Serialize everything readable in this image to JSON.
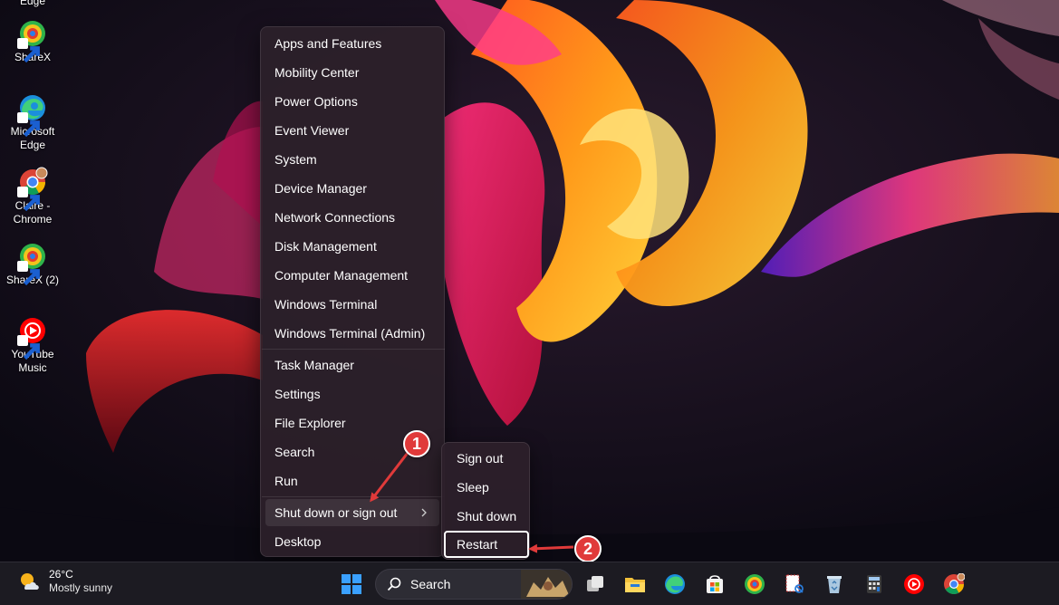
{
  "desktop": {
    "top_cut_label": "Edge",
    "icons": [
      {
        "label": "ShareX"
      },
      {
        "label": "Microsoft\nEdge"
      },
      {
        "label": "Claire -\nChrome"
      },
      {
        "label": "ShareX (2)"
      },
      {
        "label": "YouTube\nMusic"
      }
    ]
  },
  "menu": {
    "items": [
      "Apps and Features",
      "Mobility Center",
      "Power Options",
      "Event Viewer",
      "System",
      "Device Manager",
      "Network Connections",
      "Disk Management",
      "Computer Management",
      "Windows Terminal",
      "Windows Terminal (Admin)",
      "Task Manager",
      "Settings",
      "File Explorer",
      "Search",
      "Run",
      "Shut down or sign out",
      "Desktop"
    ]
  },
  "submenu": {
    "items": [
      "Sign out",
      "Sleep",
      "Shut down",
      "Restart"
    ]
  },
  "annotations": {
    "badge1": "1",
    "badge2": "2",
    "color": "#e03a3a"
  },
  "taskbar": {
    "weather_temp": "26°C",
    "weather_desc": "Mostly sunny",
    "search_label": "Search",
    "apps": [
      "start-icon",
      "task-view-icon",
      "file-explorer-icon",
      "edge-icon",
      "store-icon",
      "sharex-icon",
      "snipping-tool-icon",
      "recycle-bin-icon",
      "calculator-icon",
      "youtube-music-icon",
      "chrome-icon"
    ]
  }
}
